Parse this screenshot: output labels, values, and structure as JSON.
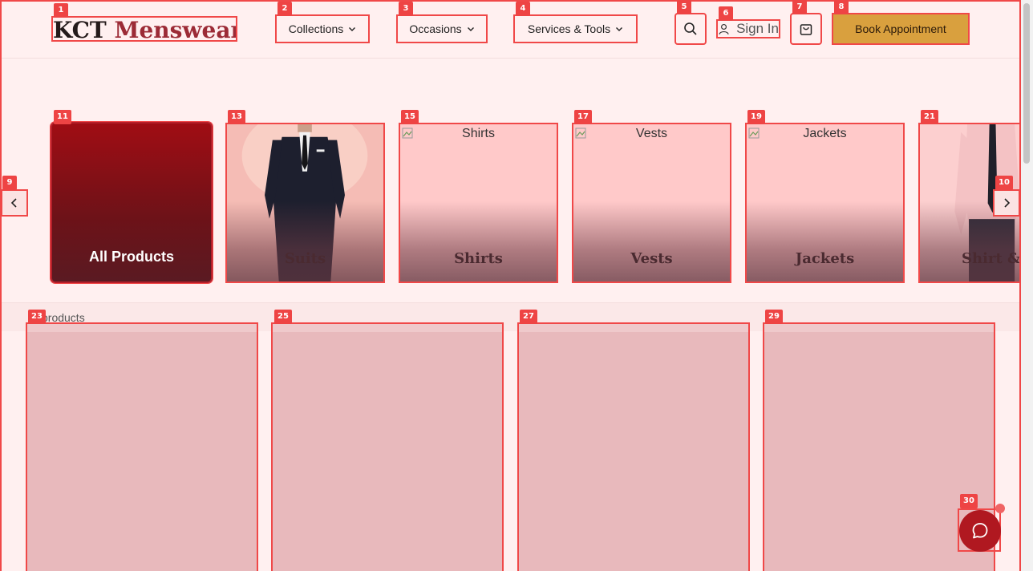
{
  "header": {
    "logo_part1": "KCT",
    "logo_part2": "Menswear",
    "nav": [
      {
        "label": "Collections"
      },
      {
        "label": "Occasions"
      },
      {
        "label": "Services & Tools"
      }
    ],
    "signin_label": "Sign In",
    "book_label": "Book Appointment"
  },
  "carousel": {
    "all_label": "All Products",
    "cards": [
      {
        "label": "Suits",
        "alt": ""
      },
      {
        "label": "Shirts",
        "alt": "Shirts"
      },
      {
        "label": "Vests",
        "alt": "Vests"
      },
      {
        "label": "Jackets",
        "alt": "Jackets"
      },
      {
        "label": "Shirt & Tie",
        "alt": ""
      }
    ]
  },
  "products": {
    "count_label": "products"
  },
  "badges": [
    "1",
    "2",
    "3",
    "4",
    "5",
    "6",
    "7",
    "8",
    "9",
    "10",
    "11",
    "13",
    "15",
    "17",
    "19",
    "21",
    "23",
    "25",
    "27",
    "29",
    "30"
  ],
  "colors": {
    "accent": "#f04848",
    "brand_red": "#9c2b36",
    "gold": "#d9a03e",
    "chat": "#b01820"
  },
  "icons": {
    "search": "search-icon",
    "user": "user-icon",
    "cart": "shopping-bag-icon",
    "chat": "chat-bubble-icon",
    "prev": "chevron-left-icon",
    "next": "chevron-right-icon"
  }
}
